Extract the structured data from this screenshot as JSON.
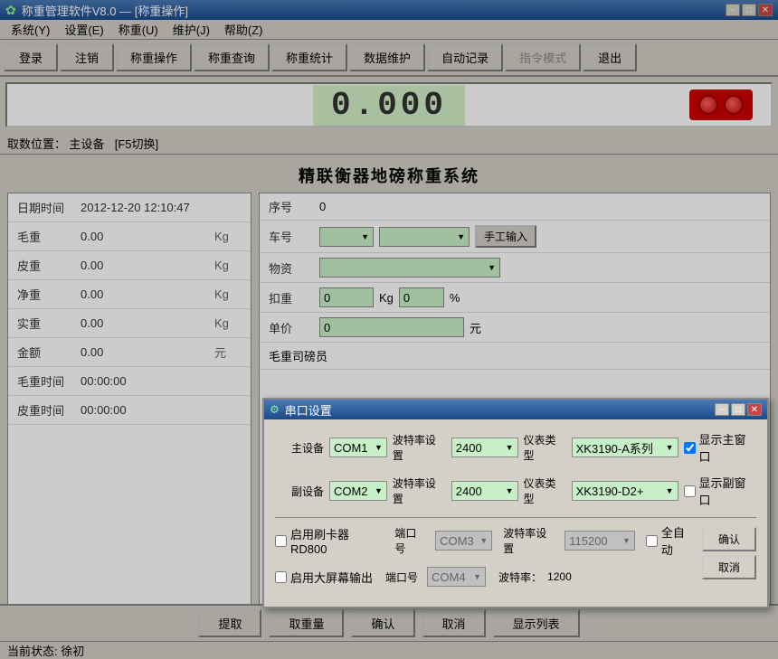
{
  "titlebar": {
    "title": "称重管理软件V8.0 — [称重操作]",
    "min_btn": "─",
    "max_btn": "□",
    "close_btn": "✕"
  },
  "menubar": {
    "items": [
      "系统(Y)",
      "设置(E)",
      "称重(U)",
      "维护(J)",
      "帮助(Z)"
    ]
  },
  "toolbar": {
    "buttons": [
      "登录",
      "注销",
      "称重操作",
      "称重查询",
      "称重统计",
      "数据维护",
      "自动记录",
      "指令模式",
      "退出"
    ]
  },
  "weight_display": {
    "value": "0.000"
  },
  "datasource": {
    "label": "取数位置：",
    "device": "主设备",
    "switch_hint": "[F5切换]"
  },
  "system_title": "精联衡器地磅称重系统",
  "left_panel": {
    "rows": [
      {
        "label": "日期时间",
        "value": "2012-12-20 12:10:47",
        "unit": ""
      },
      {
        "label": "毛重",
        "value": "0.00",
        "unit": "Kg"
      },
      {
        "label": "皮重",
        "value": "0.00",
        "unit": "Kg"
      },
      {
        "label": "净重",
        "value": "0.00",
        "unit": "Kg"
      },
      {
        "label": "实重",
        "value": "0.00",
        "unit": "Kg"
      },
      {
        "label": "金额",
        "value": "0.00",
        "unit": "元"
      },
      {
        "label": "毛重时间",
        "value": "00:00:00",
        "unit": ""
      },
      {
        "label": "皮重时间",
        "value": "00:00:00",
        "unit": ""
      }
    ]
  },
  "right_panel": {
    "serial_no_label": "序号",
    "serial_no_value": "0",
    "car_no_label": "车号",
    "manual_input_btn": "手工输入",
    "goods_label": "物资",
    "tare_label": "扣重",
    "tare_value": "0",
    "tare_unit": "Kg",
    "tare_percent": "0",
    "tare_percent_unit": "%",
    "unit_price_label": "单价",
    "unit_price_value": "0",
    "unit_price_unit": "元",
    "driver_label": "毛重司磅员"
  },
  "bottom_buttons": [
    "提取",
    "取重量",
    "确认",
    "取消",
    "显示列表"
  ],
  "status_bar": {
    "text": "当前状态: 徐初"
  },
  "modal": {
    "title": "串口设置",
    "main_device_label": "主设备",
    "main_device_value": "COM1",
    "main_baud_label": "波特率设置",
    "main_baud_value": "2400",
    "main_meter_label": "仪表类型",
    "main_meter_value": "XK3190-A系列",
    "show_main_label": "显示主窗口",
    "show_main_checked": true,
    "sub_device_label": "副设备",
    "sub_device_value": "COM2",
    "sub_baud_label": "波特率设置",
    "sub_baud_value": "2400",
    "sub_meter_label": "仪表类型",
    "sub_meter_value": "XK3190-D2+",
    "show_sub_label": "显示副窗口",
    "show_sub_checked": false,
    "card_reader_label": "启用刷卡器RD800",
    "card_port_label": "端口号",
    "card_port_value": "COM3",
    "card_baud_label": "波特率设置",
    "card_baud_value": "115200",
    "card_auto_label": "全自动",
    "card_auto_checked": false,
    "card_reader_checked": false,
    "bigscreen_label": "启用大屏幕输出",
    "big_port_label": "端口号",
    "big_port_value": "COM4",
    "big_baud_label": "波特率：",
    "big_baud_value": "1200",
    "bigscreen_checked": false,
    "confirm_btn": "确认",
    "cancel_btn": "取消"
  }
}
